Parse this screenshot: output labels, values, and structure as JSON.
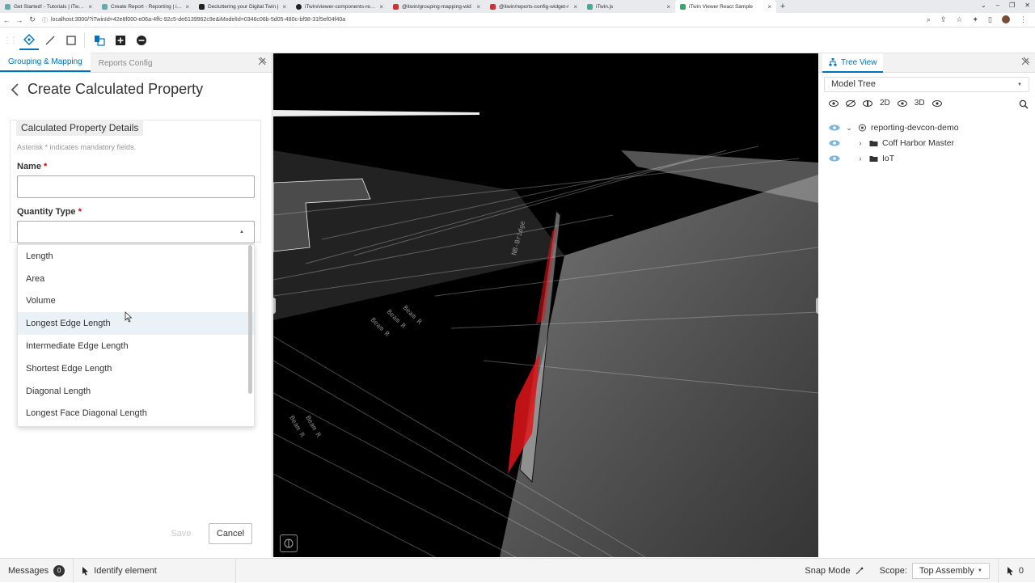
{
  "browser": {
    "tabs": [
      {
        "label": "Get Started! - Tutorials | iTwin Pl",
        "active": false
      },
      {
        "label": "Create Report - Reporting | iTwi",
        "active": false
      },
      {
        "label": "Decluttering your Digital Twin | ",
        "active": false
      },
      {
        "label": "iTwin/viewer-components-react",
        "active": false
      },
      {
        "label": "@itwin/grouping-mapping-wid",
        "active": false
      },
      {
        "label": "@itwin/reports-config-widget-r",
        "active": false
      },
      {
        "label": "iTwin.js",
        "active": false
      },
      {
        "label": "iTwin Viewer React Sample",
        "active": true
      }
    ],
    "url": "localhost:3000/?iTwinId=42e8f000-e06a-4ffc-92c5-de6139962c9e&iModelId=0346c06b-5d05-480c-bf98-31f5ef04f40a"
  },
  "left_panel": {
    "tabs": [
      "Grouping & Mapping",
      "Reports Config"
    ],
    "title": "Create Calculated Property",
    "section_title": "Calculated Property Details",
    "hint": "Asterisk * indicates mandatory fields.",
    "name_label": "Name",
    "quantity_label": "Quantity Type",
    "required_mark": "*",
    "dropdown_options": [
      "Length",
      "Area",
      "Volume",
      "Longest Edge Length",
      "Intermediate Edge Length",
      "Shortest Edge Length",
      "Diagonal Length",
      "Longest Face Diagonal Length"
    ],
    "hovered_option": "Longest Edge Length",
    "save_label": "Save",
    "cancel_label": "Cancel"
  },
  "right_panel": {
    "tab_label": "Tree View",
    "selector_value": "Model Tree",
    "tool_2d": "2D",
    "tool_3d": "3D",
    "tree": [
      {
        "label": "reporting-devcon-demo",
        "expanded": true,
        "level": 0
      },
      {
        "label": "Coff Harbor Master",
        "expanded": false,
        "level": 1
      },
      {
        "label": "IoT",
        "expanded": false,
        "level": 1
      }
    ]
  },
  "status_bar": {
    "messages_label": "Messages",
    "messages_count": "0",
    "tool_prompt": "Identify element",
    "snap_label": "Snap Mode",
    "scope_label": "Scope:",
    "scope_value": "Top Assembly",
    "selection_count": "0"
  },
  "colors": {
    "accent": "#0073ba",
    "required": "#cc0000",
    "highlight": "#e0151b"
  }
}
